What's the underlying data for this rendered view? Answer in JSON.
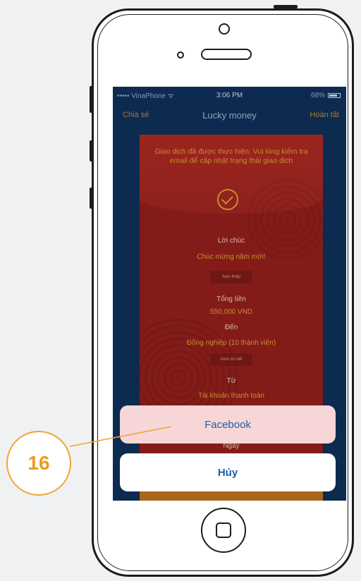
{
  "statusbar": {
    "carrier": "••••• VinaPhone ᯤ",
    "time": "3:06 PM",
    "battery": "68%"
  },
  "navbar": {
    "left": "Chia sẻ",
    "title": "Lucky money",
    "right": "Hoàn tất"
  },
  "card": {
    "message": "Giao dịch đã được thực hiện. Vui lòng kiểm tra email để cập nhật trạng thái giao dịch",
    "wish_label": "Lời chúc",
    "wish_value": "Chúc mừng năm mới!",
    "button_1": "Xem thiệp",
    "total_label": "Tổng tiền",
    "total_value": "550,000 VND",
    "to_label": "Đến",
    "to_value": "Đồng nghiệp (10 thành viên)",
    "button_2": "Xem chi tiết",
    "from_label": "Từ",
    "from_value": "Tài khoản thanh toán",
    "date_label": "Ngày"
  },
  "action_sheet": {
    "facebook": "Facebook",
    "cancel": "Hủy"
  },
  "callout": {
    "number": "16"
  },
  "colors": {
    "accent": "#f0a433",
    "link": "#1d5da8"
  }
}
